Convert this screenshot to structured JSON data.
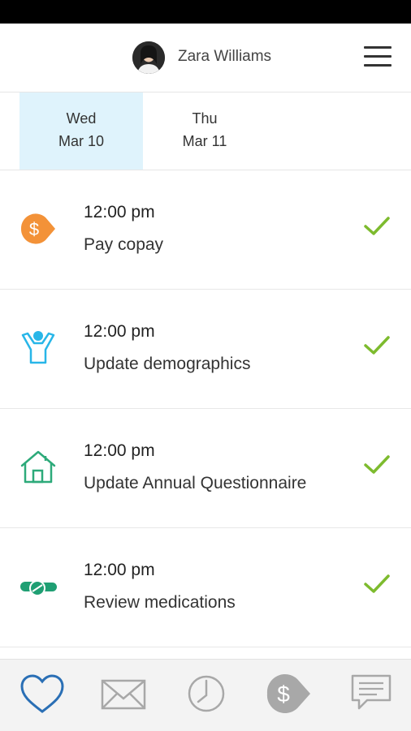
{
  "header": {
    "user_name": "Zara Williams"
  },
  "date_tabs": [
    {
      "day": "Wed",
      "date": "Mar 10",
      "active": true
    },
    {
      "day": "Thu",
      "date": "Mar 11",
      "active": false
    }
  ],
  "tasks": [
    {
      "time": "12:00 pm",
      "title": "Pay copay",
      "icon": "dollar-tag-icon",
      "completed": true
    },
    {
      "time": "12:00 pm",
      "title": "Update demographics",
      "icon": "person-icon",
      "completed": true
    },
    {
      "time": "12:00 pm",
      "title": "Update Annual Questionnaire",
      "icon": "house-icon",
      "completed": true
    },
    {
      "time": "12:00 pm",
      "title": "Review medications",
      "icon": "pills-icon",
      "completed": true
    }
  ],
  "bottom_nav": [
    {
      "icon": "heart-icon",
      "active": true
    },
    {
      "icon": "envelope-icon",
      "active": false
    },
    {
      "icon": "clock-icon",
      "active": false
    },
    {
      "icon": "dollar-tag-icon",
      "active": false
    },
    {
      "icon": "chat-icon",
      "active": false
    }
  ],
  "colors": {
    "active_tab_bg": "#dff3fc",
    "check_green": "#7dbb2e",
    "copay_orange": "#f39238",
    "demographics_blue": "#28b6e8",
    "house_green": "#2daa7a",
    "pills_green": "#1f9f73",
    "nav_active_blue": "#2a6fb5",
    "nav_inactive_gray": "#a8a8a8"
  }
}
